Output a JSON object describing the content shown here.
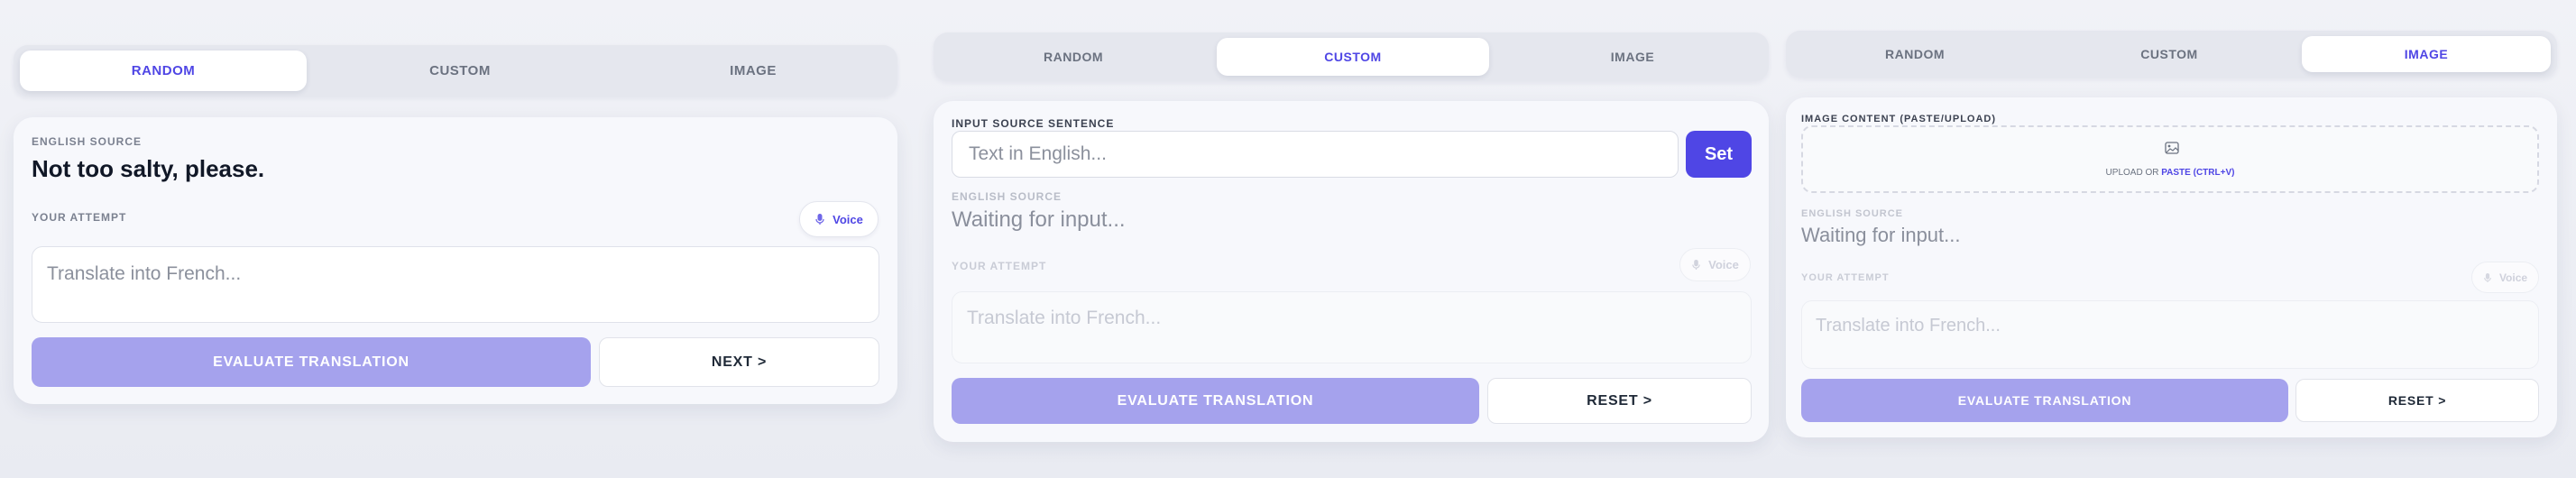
{
  "panels": [
    {
      "tabs": [
        "RANDOM",
        "CUSTOM",
        "IMAGE"
      ],
      "active_tab": "RANDOM",
      "source_label": "ENGLISH SOURCE",
      "source_text": "Not too salty, please.",
      "attempt_label": "YOUR ATTEMPT",
      "voice_label": "Voice",
      "attempt_placeholder": "Translate into French...",
      "evaluate_label": "EVALUATE TRANSLATION",
      "next_label": "NEXT >"
    },
    {
      "tabs": [
        "RANDOM",
        "CUSTOM",
        "IMAGE"
      ],
      "active_tab": "CUSTOM",
      "input_label": "INPUT SOURCE SENTENCE",
      "input_placeholder": "Text in English...",
      "set_label": "Set",
      "source_label": "ENGLISH SOURCE",
      "source_text": "Waiting for input...",
      "attempt_label": "YOUR ATTEMPT",
      "voice_label": "Voice",
      "attempt_placeholder": "Translate into French...",
      "evaluate_label": "EVALUATE TRANSLATION",
      "reset_label": "RESET >"
    },
    {
      "tabs": [
        "RANDOM",
        "CUSTOM",
        "IMAGE"
      ],
      "active_tab": "IMAGE",
      "image_label": "IMAGE CONTENT (PASTE/UPLOAD)",
      "upload_prefix": "UPLOAD OR",
      "upload_link": "PASTE (CTRL+V)",
      "source_label": "ENGLISH SOURCE",
      "source_text": "Waiting for input...",
      "attempt_label": "YOUR ATTEMPT",
      "voice_label": "Voice",
      "attempt_placeholder": "Translate into French...",
      "evaluate_label": "EVALUATE TRANSLATION",
      "reset_label": "RESET >"
    }
  ],
  "colors": {
    "accent": "#4f46e5",
    "accent_light": "#a5a2ed",
    "background": "#eef0f5",
    "card": "#f7f8fc"
  },
  "icons": [
    "microphone-icon",
    "image-icon"
  ]
}
